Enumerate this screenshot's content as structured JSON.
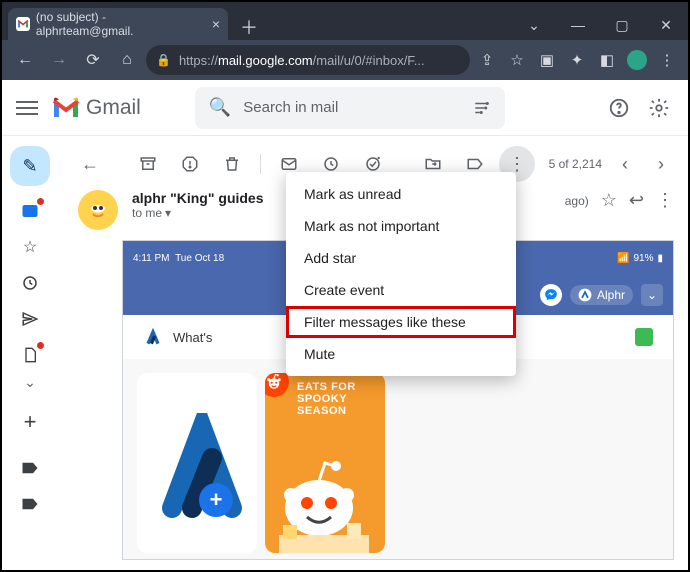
{
  "browser": {
    "tab_title": "(no subject) - alphrteam@gmail.",
    "url_pre": "https://",
    "url_domain": "mail.google.com",
    "url_rest": "/mail/u/0/#inbox/F...",
    "newtab_glyph": "＋"
  },
  "gmail_header": {
    "product": "Gmail",
    "search_placeholder": "Search in mail"
  },
  "toolbar": {
    "counter": "5 of 2,214"
  },
  "message": {
    "sender_name": "alphr \"King\" guides",
    "to_line": "to me",
    "time_suffix": "ago)"
  },
  "menu": {
    "items": [
      "Mark as unread",
      "Mark as not important",
      "Add star",
      "Create event",
      "Filter messages like these",
      "Mute"
    ],
    "highlight_index": 4
  },
  "phone": {
    "time": "4:11 PM",
    "date": "Tue Oct 18",
    "pill_label": "Alphr",
    "whats_label": "What's",
    "cardB_line1": "EATS FOR",
    "cardB_line2": "SPOOKY SEASON"
  }
}
